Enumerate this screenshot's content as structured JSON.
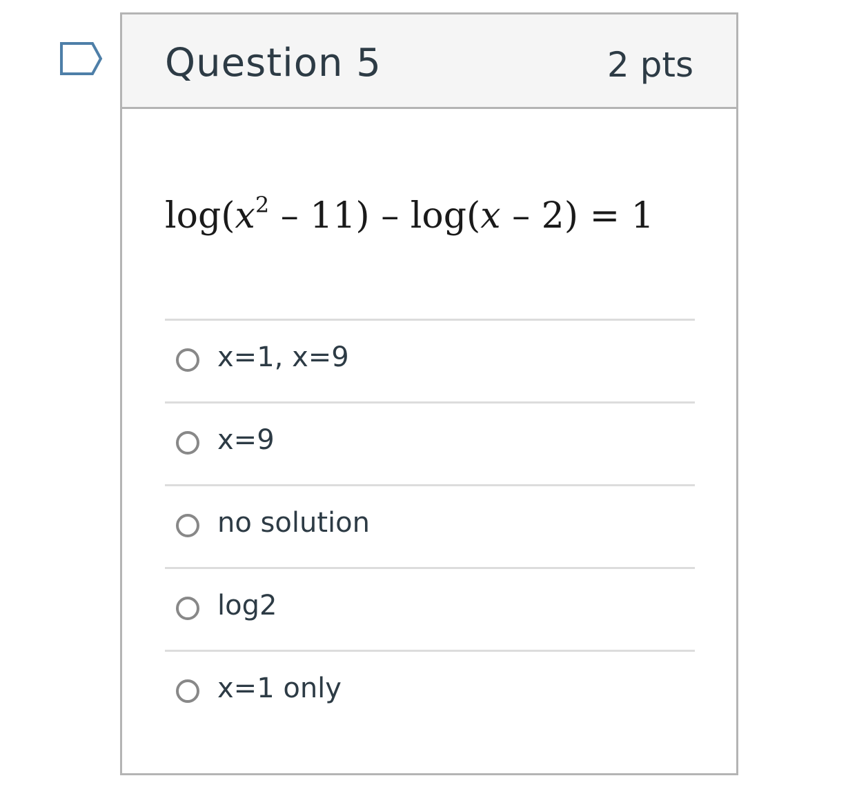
{
  "flag_icon": "flag-outline-icon",
  "question": {
    "title": "Question 5",
    "points": "2 pts"
  },
  "equation": {
    "part1": "log(",
    "var1": "x",
    "exp": "2",
    "part2": " – 11) – log(",
    "var2": "x",
    "part3": " – 2) = 1"
  },
  "answers": [
    {
      "label": "x=1, x=9",
      "selected": false
    },
    {
      "label": "x=9",
      "selected": false
    },
    {
      "label": "no solution",
      "selected": false
    },
    {
      "label": "log2",
      "selected": false
    },
    {
      "label": "x=1 only",
      "selected": false
    }
  ],
  "colors": {
    "header_bg": "#f5f5f5",
    "border": "#b4b4b4",
    "text": "#2d3b45",
    "radio": "#888888",
    "flag": "#4e7fa8"
  }
}
